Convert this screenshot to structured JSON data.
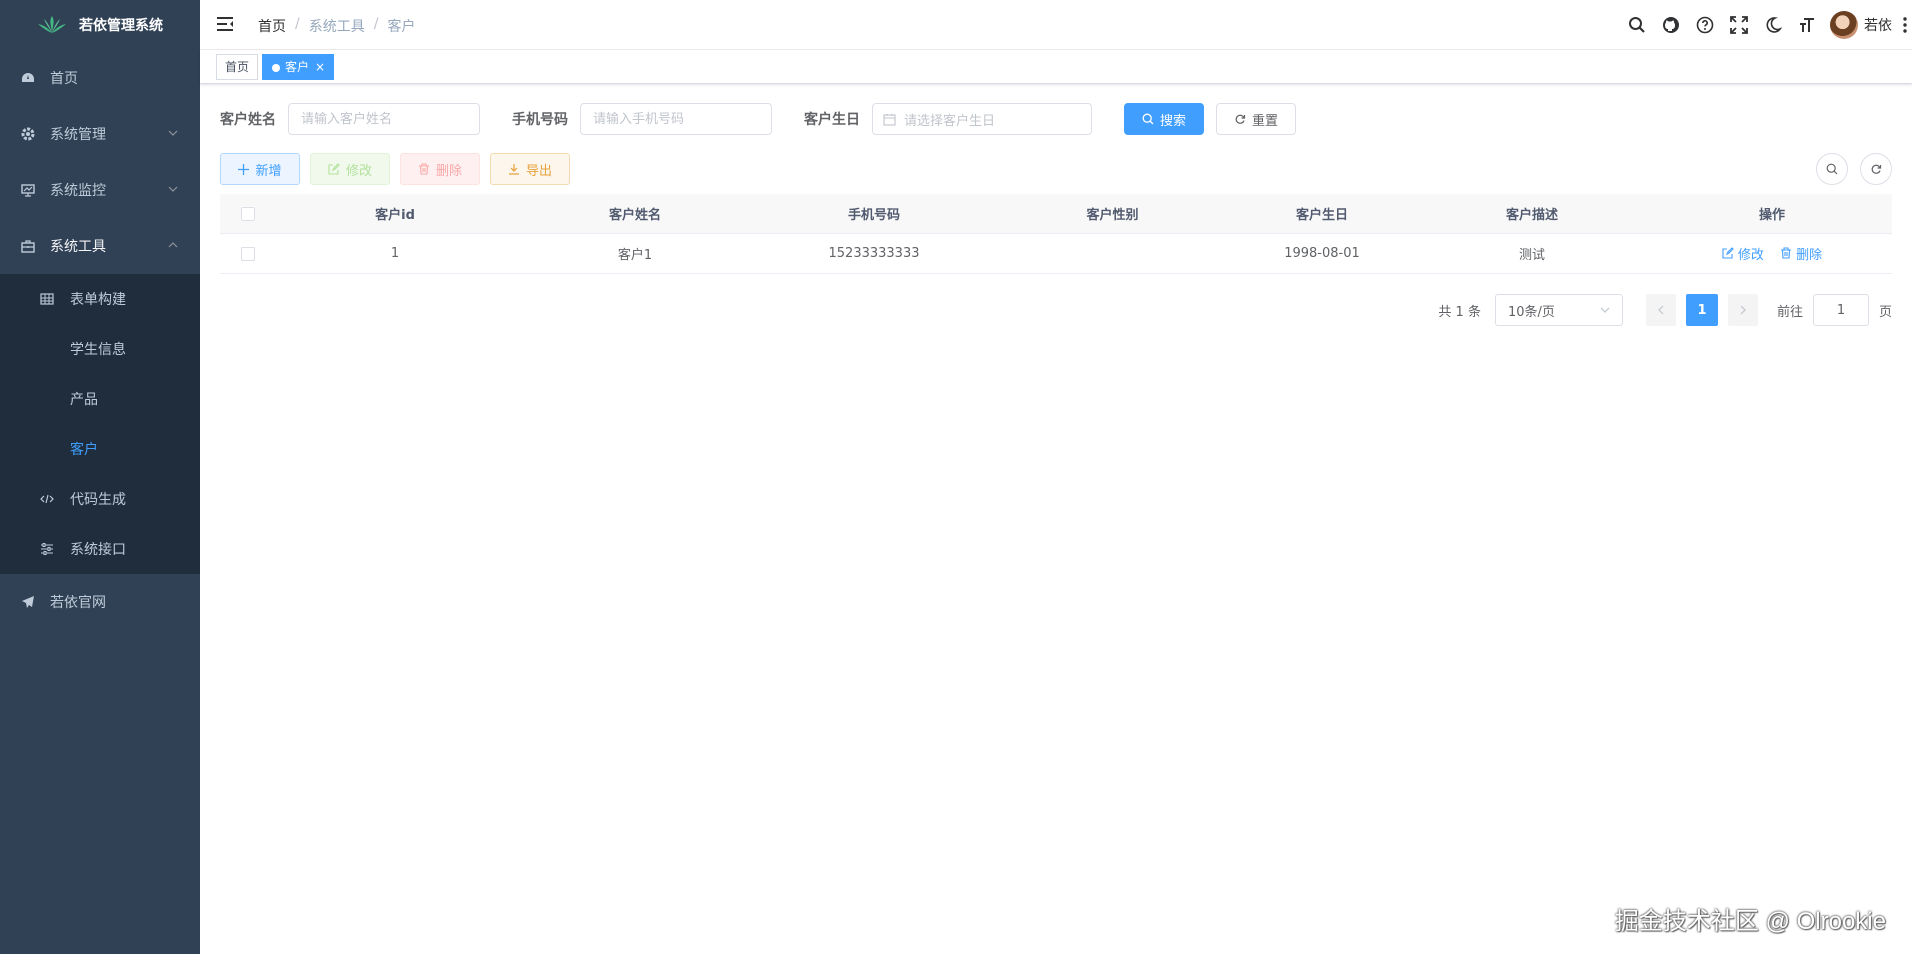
{
  "app": {
    "title": "若依管理系统"
  },
  "sidebar": {
    "items": [
      {
        "label": "首页"
      },
      {
        "label": "系统管理"
      },
      {
        "label": "系统监控"
      },
      {
        "label": "系统工具"
      }
    ],
    "sub_items": [
      {
        "label": "表单构建"
      },
      {
        "label": "学生信息"
      },
      {
        "label": "产品"
      },
      {
        "label": "客户"
      },
      {
        "label": "代码生成"
      },
      {
        "label": "系统接口"
      }
    ],
    "external": {
      "label": "若依官网"
    },
    "active_color": "#409eff"
  },
  "navbar": {
    "breadcrumb": [
      "首页",
      "系统工具",
      "客户"
    ],
    "user_name": "若依"
  },
  "tags": [
    {
      "label": "首页"
    },
    {
      "label": "客户",
      "close": "×"
    }
  ],
  "search_form": {
    "name_label": "客户姓名",
    "name_placeholder": "请输入客户姓名",
    "phone_label": "手机号码",
    "phone_placeholder": "请输入手机号码",
    "birthday_label": "客户生日",
    "birthday_placeholder": "请选择客户生日",
    "search_button": "搜索",
    "reset_button": "重置"
  },
  "toolbar": {
    "add": "新增",
    "edit": "修改",
    "delete": "删除",
    "export": "导出"
  },
  "table": {
    "columns": [
      "客户id",
      "客户姓名",
      "手机号码",
      "客户性别",
      "客户生日",
      "客户描述",
      "操作"
    ],
    "rows": [
      {
        "id": "1",
        "name": "客户1",
        "phone": "15233333333",
        "gender": "",
        "birthday": "1998-08-01",
        "desc": "测试",
        "edit": "修改",
        "delete": "删除"
      }
    ]
  },
  "pagination": {
    "total": "共 1 条",
    "page_size": "10条/页",
    "current": "1",
    "goto_label": "前往",
    "goto_value": "1",
    "page_suffix": "页"
  },
  "watermark": "掘金技术社区 @ Olrookie",
  "colors": {
    "primary": "#409eff",
    "sidebar_bg": "#304156",
    "submenu_bg": "#1f2d3d"
  }
}
